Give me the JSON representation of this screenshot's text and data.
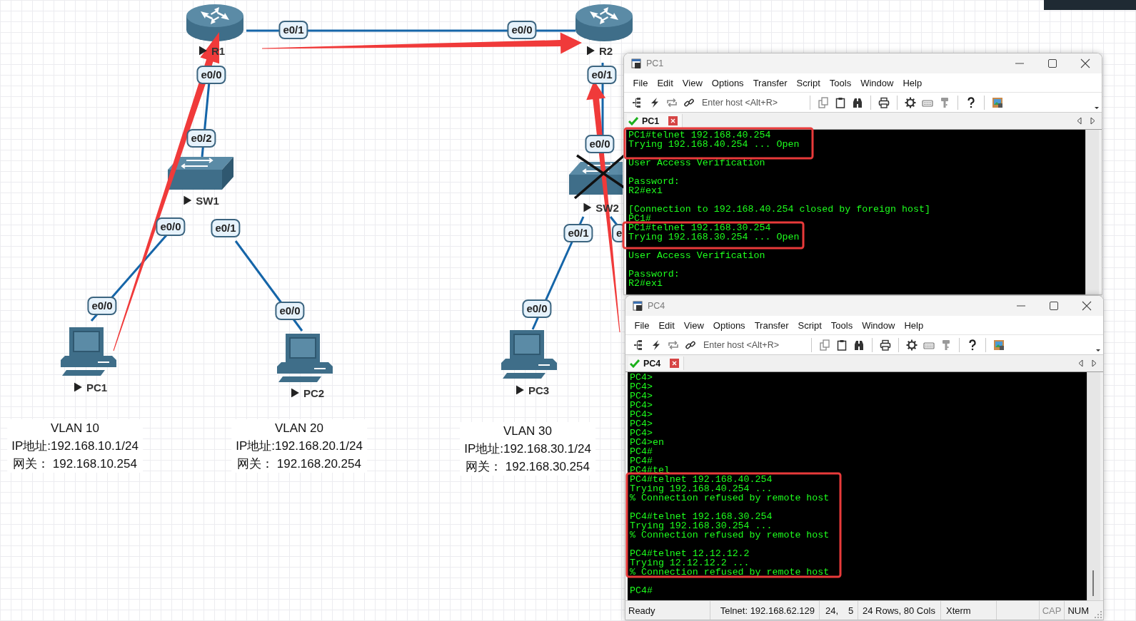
{
  "topology": {
    "nodes": [
      {
        "kind": "router",
        "label": "R1"
      },
      {
        "kind": "router",
        "label": "R2"
      },
      {
        "kind": "switch",
        "label": "SW1"
      },
      {
        "kind": "switch",
        "label": "SW2"
      },
      {
        "kind": "pc",
        "label": "PC1"
      },
      {
        "kind": "pc",
        "label": "PC2"
      },
      {
        "kind": "pc",
        "label": "PC3"
      }
    ],
    "ports": [
      "e0/1",
      "e0/0",
      "e0/0",
      "e0/2",
      "e0/0",
      "e0/1",
      "e0/0",
      "e0/0",
      "e0/1",
      "e0/0",
      "e0/1",
      "e",
      "e0/0"
    ],
    "notes": [
      {
        "lines": [
          "VLAN 10",
          "IP地址:192.168.10.1/24",
          "网关： 192.168.10.254"
        ]
      },
      {
        "lines": [
          "VLAN 20",
          "IP地址:192.168.20.1/24",
          "网关： 192.168.20.254"
        ]
      },
      {
        "lines": [
          "VLAN 30",
          "IP地址:192.168.30.1/24",
          "网关： 192.168.30.254"
        ]
      }
    ]
  },
  "windows": [
    {
      "title": "PC1",
      "menu": [
        "File",
        "Edit",
        "View",
        "Options",
        "Transfer",
        "Script",
        "Tools",
        "Window",
        "Help"
      ],
      "host_placeholder": "Enter host <Alt+R>",
      "tab": {
        "label": "PC1",
        "connected": true
      },
      "terminal": [
        [
          "PC1#telnet 192.168.40.254",
          "Trying 192.168.40.254 ... Open"
        ],
        [
          "User Access Verification"
        ],
        [
          "Password:",
          "R2#exi"
        ],
        [
          "[Connection to 192.168.40.254 closed by foreign host]",
          "PC1#",
          "PC1#telnet 192.168.30.254",
          "Trying 192.168.30.254 ... Open"
        ],
        [
          "User Access Verification"
        ],
        [
          "Password:",
          "R2#exi"
        ]
      ]
    },
    {
      "title": "PC4",
      "menu": [
        "File",
        "Edit",
        "View",
        "Options",
        "Transfer",
        "Script",
        "Tools",
        "Window",
        "Help"
      ],
      "host_placeholder": "Enter host <Alt+R>",
      "tab": {
        "label": "PC4",
        "connected": true
      },
      "terminal": [
        [
          "PC4>",
          "PC4>",
          "PC4>",
          "PC4>",
          "PC4>",
          "PC4>",
          "PC4>",
          "PC4>en",
          "PC4#",
          "PC4#",
          "PC4#tel",
          "PC4#telnet 192.168.40.254",
          "Trying 192.168.40.254 ...",
          "% Connection refused by remote host"
        ],
        [
          "PC4#telnet 192.168.30.254",
          "Trying 192.168.30.254 ...",
          "% Connection refused by remote host"
        ],
        [
          "PC4#telnet 12.12.12.2",
          "Trying 12.12.12.2 ...",
          "% Connection refused by remote host"
        ],
        [
          "PC4#"
        ]
      ],
      "status_bar": {
        "state": "Ready",
        "connection": "Telnet: 192.168.62.129",
        "row": "24,",
        "column": "5",
        "size": "24 Rows, 80 Cols",
        "emulation": "Xterm",
        "indicators": [
          {
            "label": "CAP",
            "on": false
          },
          {
            "label": "NUM",
            "on": true
          }
        ]
      }
    }
  ]
}
